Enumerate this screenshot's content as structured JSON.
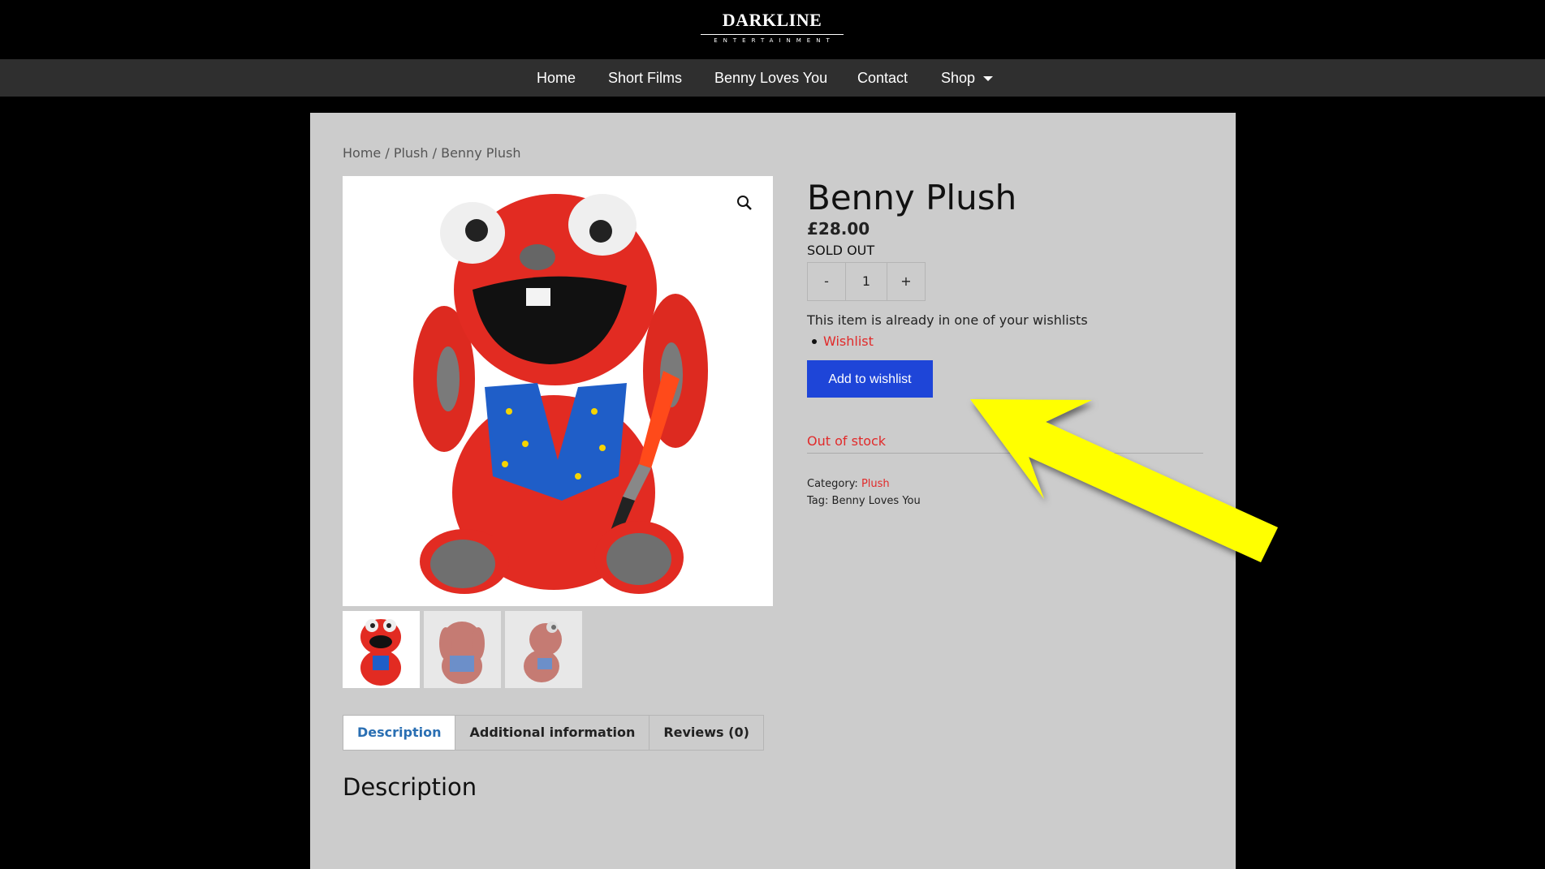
{
  "header": {
    "logo_main": "DARKLINE",
    "logo_sub": "ENTERTAINMENT"
  },
  "nav": {
    "items": [
      "Home",
      "Short Films",
      "Benny Loves You",
      "Contact",
      "Shop"
    ]
  },
  "breadcrumb": {
    "home": "Home",
    "sep1": " / ",
    "category": "Plush",
    "sep2": " / ",
    "current": "Benny Plush"
  },
  "product": {
    "title": "Benny Plush",
    "price": "£28.00",
    "stock_label": "SOLD OUT",
    "quantity": {
      "minus": "-",
      "value": "1",
      "plus": "+"
    },
    "wishlist_note": "This item is already in one of your wishlists",
    "wishlist_link": "Wishlist",
    "add_to_wishlist": "Add to wishlist",
    "availability": "Out of stock",
    "category_label": "Category: ",
    "category_value": "Plush",
    "tag_label": "Tag: ",
    "tag_value": "Benny Loves You"
  },
  "tabs": [
    "Description",
    "Additional information",
    "Reviews (0)"
  ],
  "description_heading": "Description",
  "colors": {
    "accent_blue": "#1e45d8",
    "link_red": "#e12a2a",
    "annotation_yellow": "#ffff00"
  },
  "icons": [
    "zoom-icon",
    "caret-down-icon",
    "plush-product-image",
    "annotation-arrow"
  ]
}
